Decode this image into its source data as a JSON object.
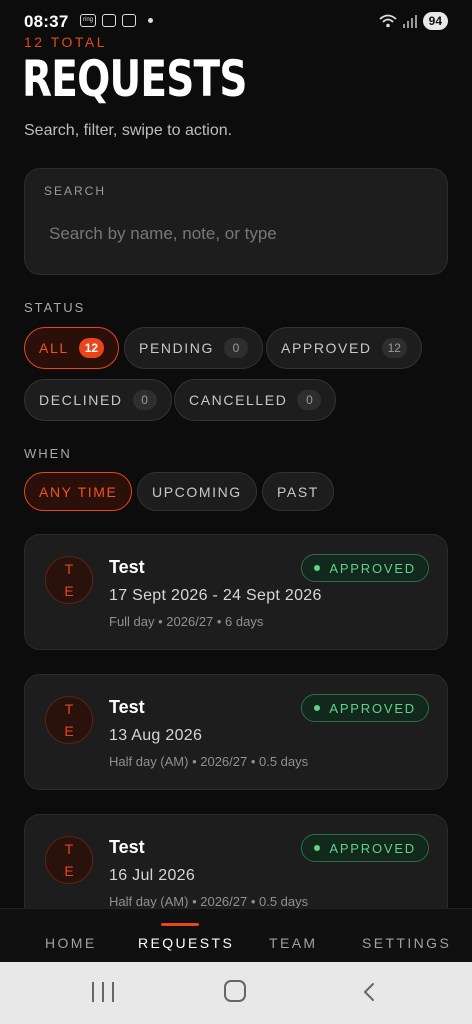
{
  "status_bar": {
    "time": "08:37",
    "icon_text": "ring",
    "battery": "94"
  },
  "header": {
    "total": "12 TOTAL",
    "title": "REQUESTS",
    "subtitle": "Search, filter, swipe to action."
  },
  "search": {
    "label": "SEARCH",
    "placeholder": "Search by name, note, or type",
    "value": ""
  },
  "status_filter": {
    "label": "STATUS",
    "chips": [
      {
        "label": "ALL",
        "count": "12",
        "active": true
      },
      {
        "label": "PENDING",
        "count": "0",
        "active": false
      },
      {
        "label": "APPROVED",
        "count": "12",
        "active": false
      },
      {
        "label": "DECLINED",
        "count": "0",
        "active": false
      },
      {
        "label": "CANCELLED",
        "count": "0",
        "active": false
      }
    ]
  },
  "when_filter": {
    "label": "WHEN",
    "chips": [
      {
        "label": "ANY TIME",
        "active": true
      },
      {
        "label": "UPCOMING",
        "active": false
      },
      {
        "label": "PAST",
        "active": false
      }
    ]
  },
  "requests": [
    {
      "initial_1": "T",
      "initial_2": "E",
      "name": "Test",
      "dates": "17 Sept 2026 - 24 Sept 2026",
      "meta": "Full day • 2026/27 • 6 days",
      "status": "APPROVED"
    },
    {
      "initial_1": "T",
      "initial_2": "E",
      "name": "Test",
      "dates": "13 Aug 2026",
      "meta": "Half day (AM) • 2026/27 • 0.5 days",
      "status": "APPROVED"
    },
    {
      "initial_1": "T",
      "initial_2": "E",
      "name": "Test",
      "dates": "16 Jul 2026",
      "meta": "Half day (AM) • 2026/27 • 0.5 days",
      "status": "APPROVED"
    }
  ],
  "bottom_nav": {
    "items": [
      {
        "label": "HOME",
        "active": false
      },
      {
        "label": "REQUESTS",
        "active": true
      },
      {
        "label": "TEAM",
        "active": false
      },
      {
        "label": "SETTINGS",
        "active": false
      }
    ]
  },
  "colors": {
    "accent": "#e8451a",
    "approved": "#5fd28a",
    "background": "#0c0c0c",
    "card": "#1d1d1d"
  },
  "icons": [
    "wifi-icon",
    "signal-icon",
    "recent-apps-icon",
    "home-icon",
    "back-icon"
  ]
}
